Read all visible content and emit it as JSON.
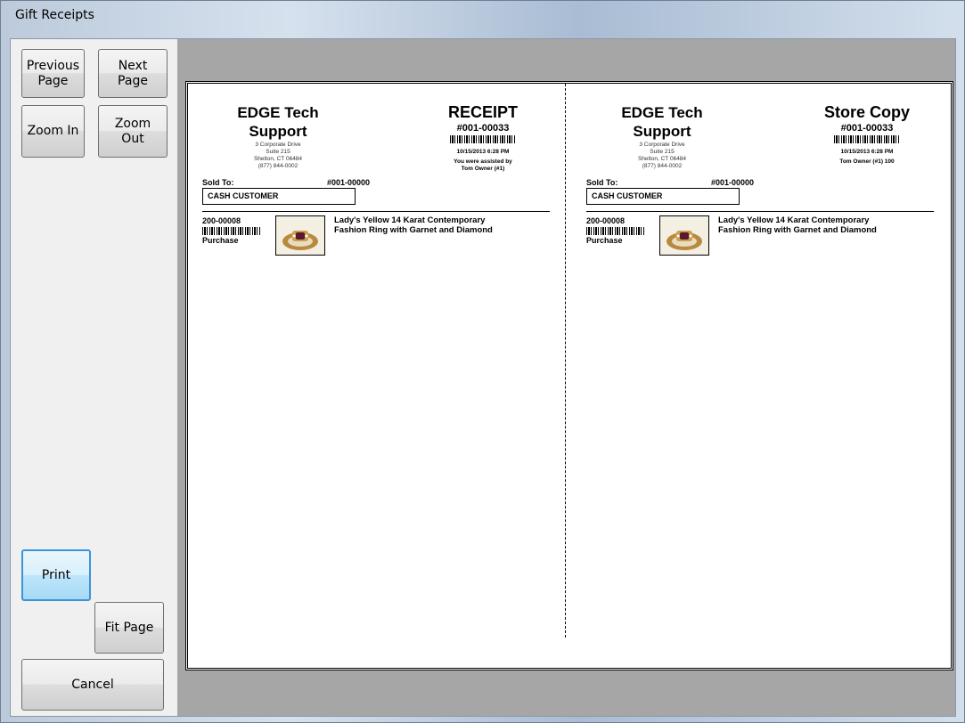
{
  "window": {
    "title": "Gift Receipts"
  },
  "buttons": {
    "previous_page": "Previous\nPage",
    "next_page": "Next\nPage",
    "zoom_in": "Zoom In",
    "zoom_out": "Zoom\nOut",
    "print": "Print",
    "fit_page": "Fit Page",
    "cancel": "Cancel"
  },
  "receipts": [
    {
      "company": "EDGE Tech\nSupport",
      "address": [
        "3 Corporate Drive",
        "Suite 215",
        "Shelton, CT 06484",
        "(877) 844-0002"
      ],
      "title": "RECEIPT",
      "number": "#001-00033",
      "date": "10/15/2013 6:28 PM",
      "assisted": "You were assisted by\nTom Owner (#1)",
      "sold_to_label": "Sold To:",
      "sold_to_number": "#001-00000",
      "customer": "CASH CUSTOMER",
      "item": {
        "number": "200-00008",
        "type": "Purchase",
        "description": "Lady's Yellow 14 Karat Contemporary\nFashion Ring with Garnet and Diamond"
      }
    },
    {
      "company": "EDGE Tech\nSupport",
      "address": [
        "3 Corporate Drive",
        "Suite 215",
        "Shelton, CT 06484",
        "(877) 844-0002"
      ],
      "title": "Store Copy",
      "number": "#001-00033",
      "date": "10/15/2013 6:28 PM",
      "assisted": "Tom Owner (#1) 100",
      "sold_to_label": "Sold To:",
      "sold_to_number": "#001-00000",
      "customer": "CASH CUSTOMER",
      "item": {
        "number": "200-00008",
        "type": "Purchase",
        "description": "Lady's Yellow 14 Karat Contemporary\nFashion Ring with Garnet and Diamond"
      }
    }
  ],
  "colors": {
    "focus_border": "#3c94d6",
    "preview_bg": "#a6a6a6"
  }
}
